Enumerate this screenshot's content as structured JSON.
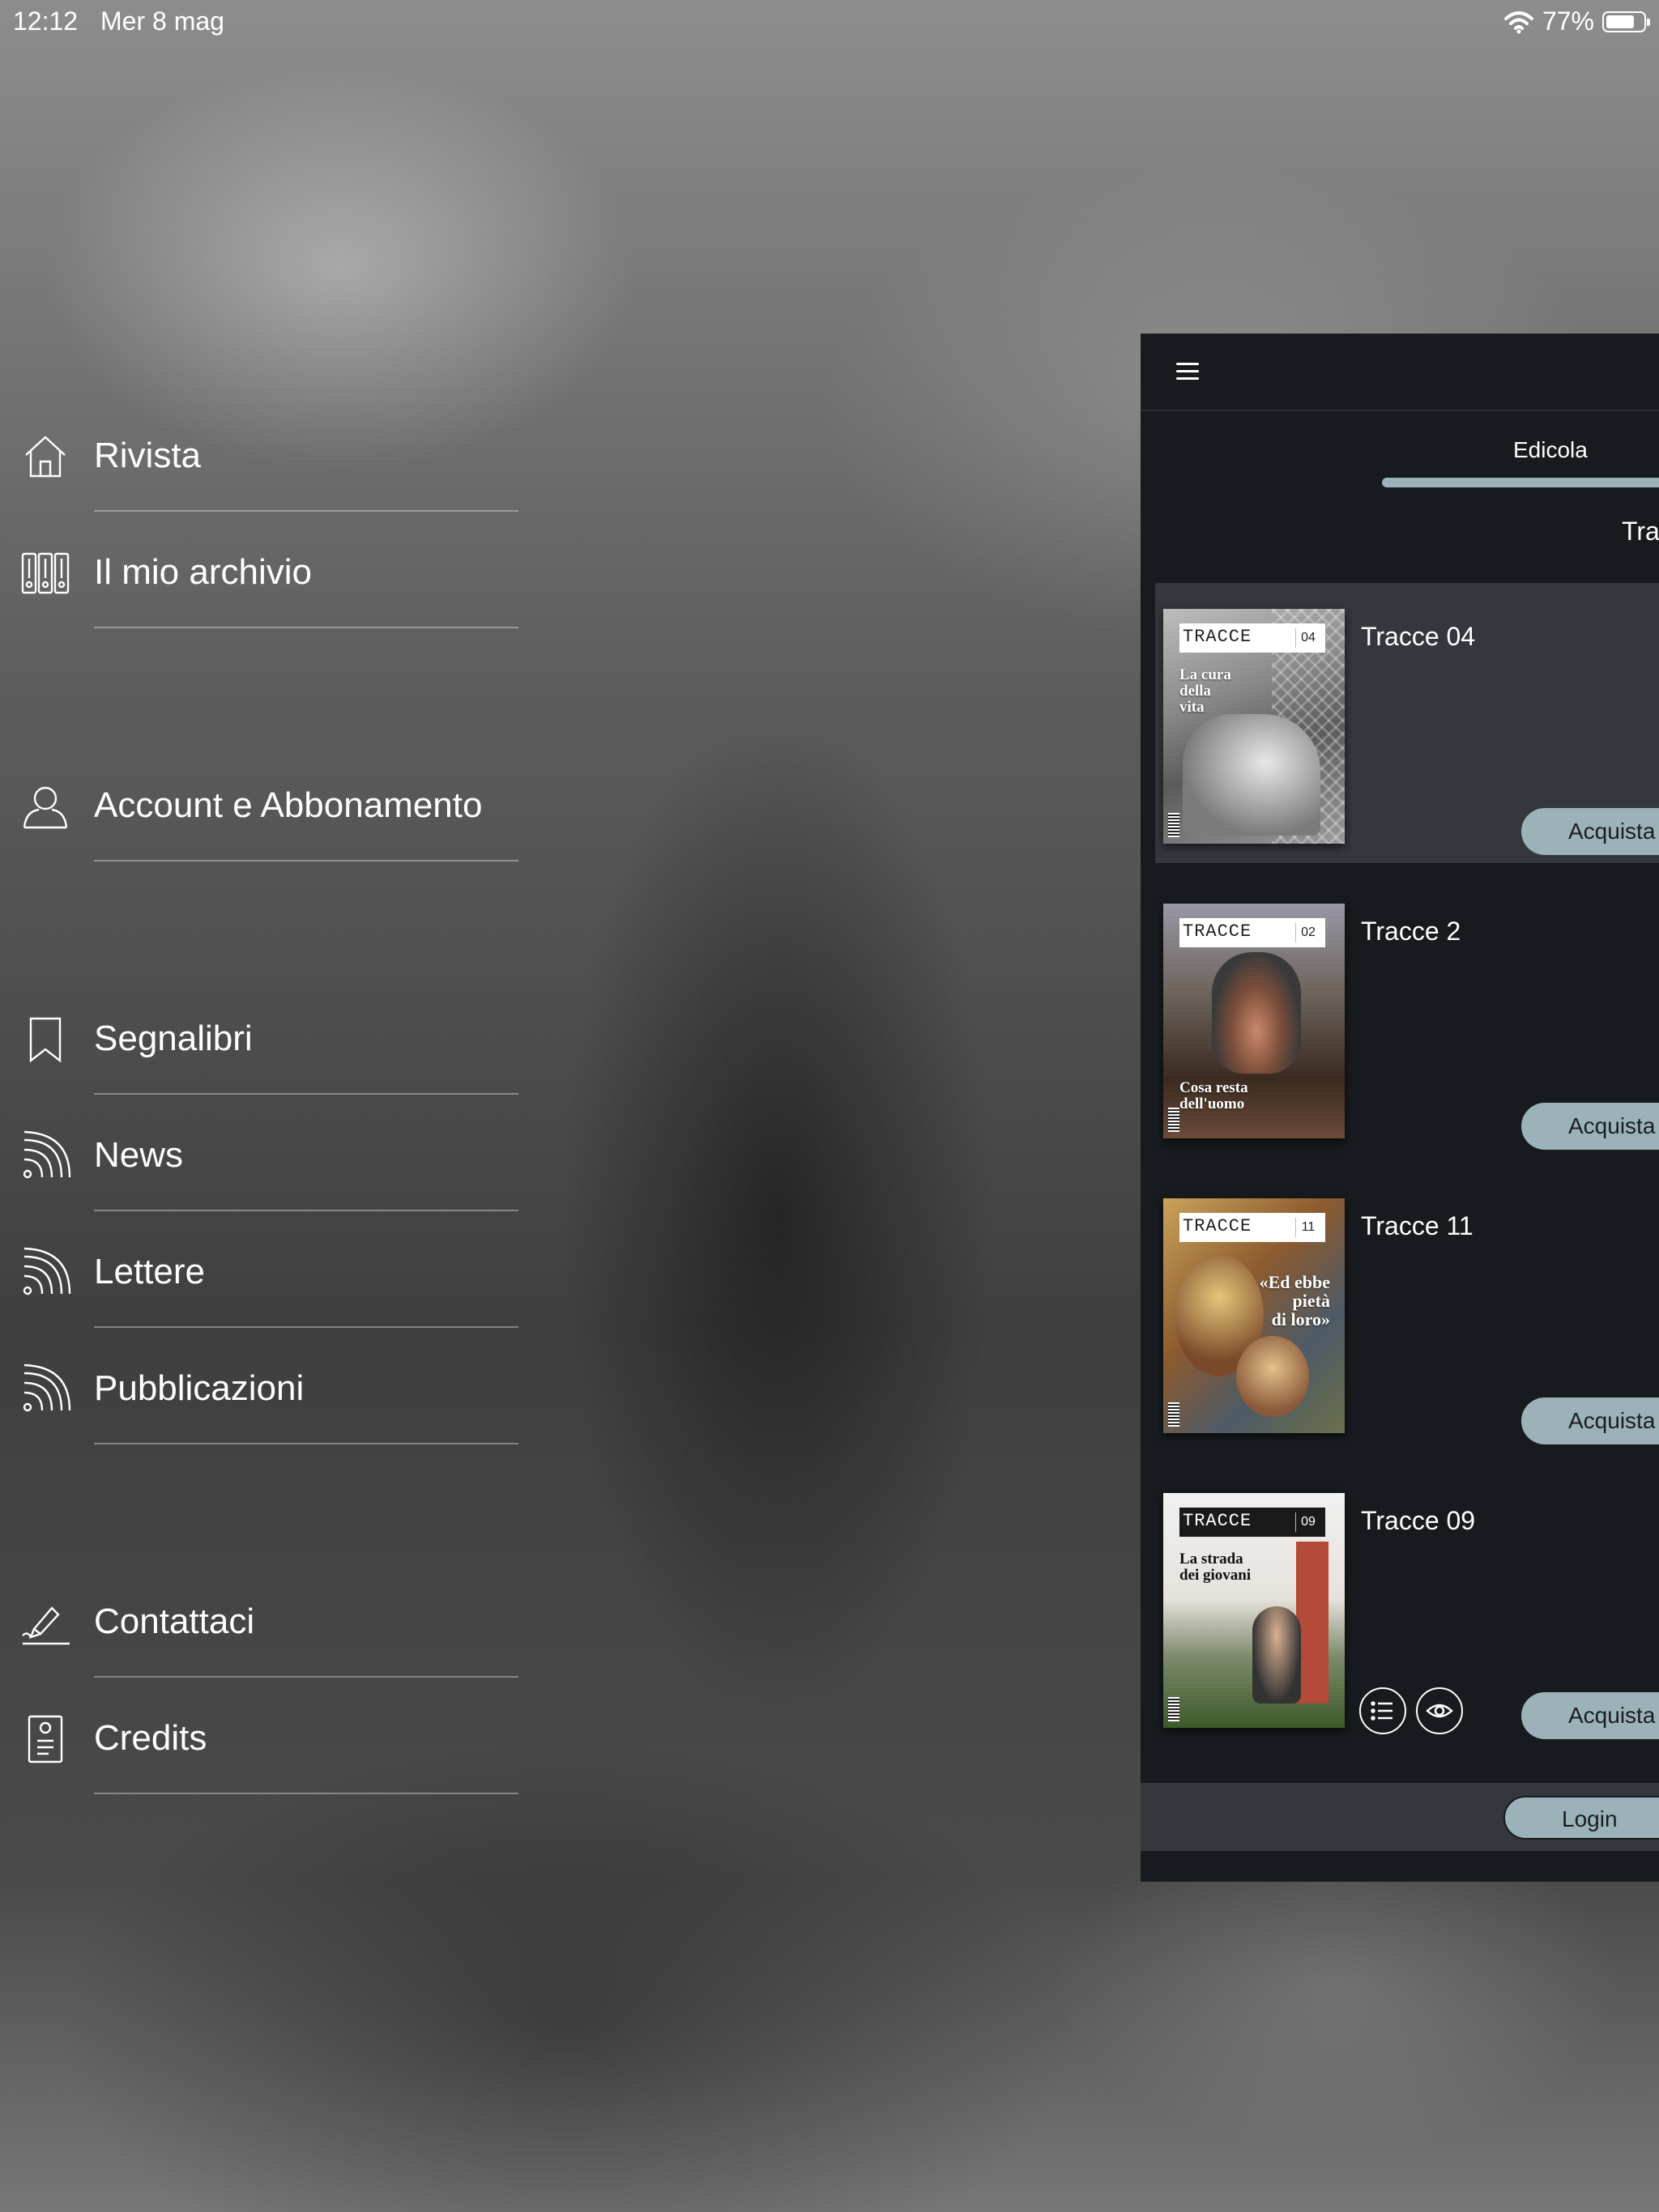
{
  "status_bar": {
    "time": "12:12",
    "date": "Mer 8 mag",
    "battery_percent": "77%",
    "battery_level": 0.77
  },
  "menu": {
    "items": [
      {
        "label": "Rivista",
        "icon": "home-icon"
      },
      {
        "label": "Il mio archivio",
        "icon": "archive-binders-icon"
      },
      {
        "label": "Account e Abbonamento",
        "icon": "user-icon"
      },
      {
        "label": "Segnalibri",
        "icon": "bookmark-icon"
      },
      {
        "label": "News",
        "icon": "rss-icon"
      },
      {
        "label": "Lettere",
        "icon": "rss-icon"
      },
      {
        "label": "Pubblicazioni",
        "icon": "rss-icon"
      },
      {
        "label": "Contattaci",
        "icon": "pen-signature-icon"
      },
      {
        "label": "Credits",
        "icon": "id-card-icon"
      }
    ]
  },
  "panel": {
    "tabs": {
      "active": "Edicola",
      "partial": "Tra"
    },
    "issues": [
      {
        "title": "Tracce 04",
        "cover_logo": "TRACCE",
        "cover_number": "04",
        "cover_headline": "La cura\ndella\nvita",
        "buy_label": "Acquista"
      },
      {
        "title": "Tracce 2",
        "cover_logo": "TRACCE",
        "cover_number": "02",
        "cover_headline": "Cosa resta\ndell'uomo",
        "buy_label": "Acquista"
      },
      {
        "title": "Tracce 11",
        "cover_logo": "TRACCE",
        "cover_number": "11",
        "cover_headline": "«Ed ebbe\npietà\ndi loro»",
        "buy_label": "Acquista"
      },
      {
        "title": "Tracce 09",
        "cover_logo": "TRACCE",
        "cover_number": "09",
        "cover_headline": "La strada\ndei giovani",
        "buy_label": "Acquista",
        "actions": [
          "list-icon",
          "eye-icon"
        ]
      }
    ],
    "login_label": "Login"
  },
  "colors": {
    "accent": "#9bb3b8",
    "panel_bg": "#171a1e",
    "row_bg": "#34373d"
  }
}
